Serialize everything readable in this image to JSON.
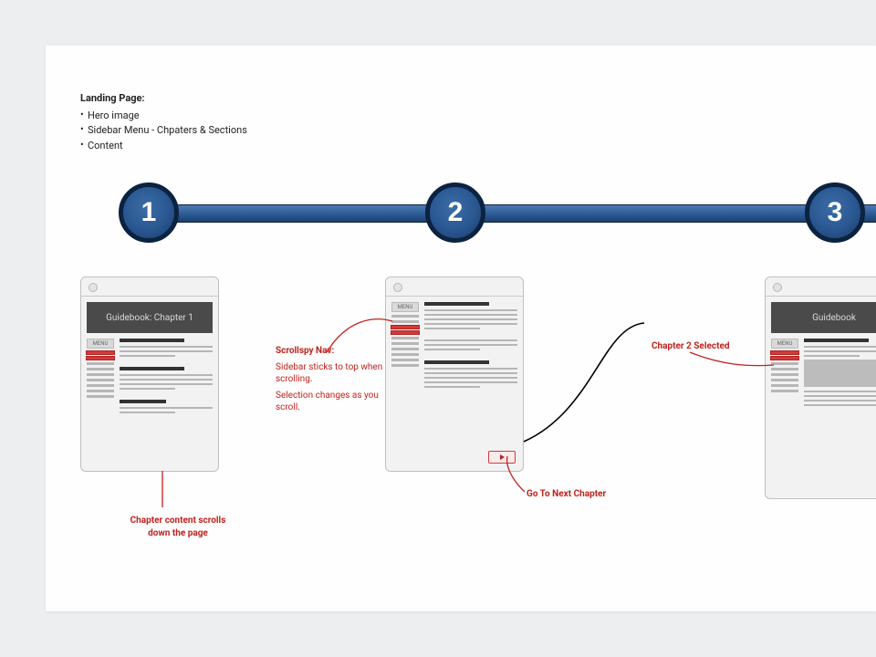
{
  "intro": {
    "title": "Landing Page:",
    "items": [
      "Hero image",
      "Sidebar Menu - Chpaters & Sections",
      "Content"
    ]
  },
  "steps": {
    "s1": "1",
    "s2": "2",
    "s3": "3"
  },
  "thumbs": {
    "t1": {
      "hero": "Guidebook: Chapter 1",
      "menu": "MENU"
    },
    "t2": {
      "menu": "MENU"
    },
    "t3": {
      "hero": "Guidebook",
      "menu": "MENU"
    }
  },
  "annotations": {
    "scrollspy_title": "Scrollspy Nav:",
    "scrollspy_l1": "Sidebar sticks to top when scrolling.",
    "scrollspy_l2": "Selection changes as you scroll.",
    "below": "Chapter content scrolls down the page",
    "next": "Go To Next Chapter",
    "ch2": "Chapter 2 Selected"
  }
}
